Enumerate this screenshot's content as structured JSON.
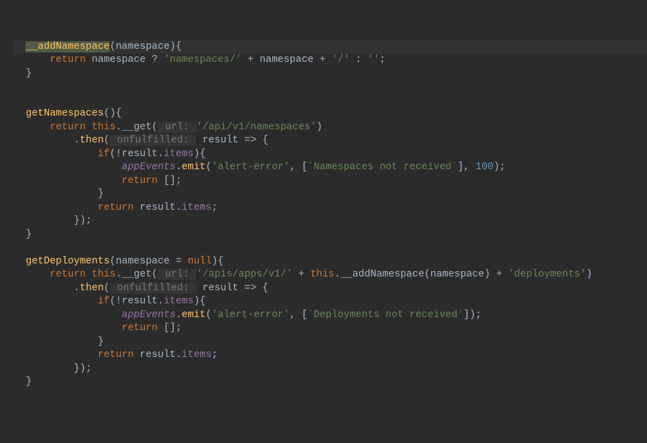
{
  "lines": {
    "l1_indent": "  ",
    "l1_method": "__addNamespace",
    "l1_rest": "(namespace){",
    "l2_indent": "      ",
    "l2_return": "return",
    "l2_ns1": " namespace ",
    "l2_q": "?",
    "l2_s1": " 'namespaces/' ",
    "l2_plus1": "+",
    "l2_ns2": " namespace ",
    "l2_plus2": "+",
    "l2_s2": " '/' ",
    "l2_colon": ":",
    "l2_s3": " ''",
    "l2_semi": ";",
    "l3": "  }",
    "l5_indent": "  ",
    "l5_method": "getNamespaces",
    "l5_rest": "(){",
    "l6_indent": "      ",
    "l6_return": "return",
    "l6_sp": " ",
    "l6_this": "this",
    "l6_dot": ".",
    "l6_get": "__get",
    "l6_paren": "(",
    "l6_hint": " url: ",
    "l6_str": "'/api/v1/namespaces'",
    "l6_end": ")",
    "l7_indent": "          .",
    "l7_then": "then",
    "l7_paren": "(",
    "l7_hint": " onfulfilled: ",
    "l7_rest": " result => {",
    "l8_indent": "              ",
    "l8_if": "if",
    "l8_rest": "(!result.",
    "l8_items": "items",
    "l8_end": "){",
    "l9_indent": "                  ",
    "l9_app": "appEvents",
    "l9_dot": ".",
    "l9_emit": "emit",
    "l9_paren": "(",
    "l9_s1": "'alert-error'",
    "l9_comma1": ", [",
    "l9_tmpl": "`Namespaces not received`",
    "l9_comma2": "], ",
    "l9_num": "100",
    "l9_end": ");",
    "l10_indent": "                  ",
    "l10_return": "return",
    "l10_rest": " [];",
    "l11": "              }",
    "l12_indent": "              ",
    "l12_return": "return",
    "l12_rest": " result.",
    "l12_items": "items",
    "l12_semi": ";",
    "l13": "          });",
    "l14": "  }",
    "l16_indent": "  ",
    "l16_method": "getDeployments",
    "l16_rest1": "(namespace = ",
    "l16_null": "null",
    "l16_rest2": "){",
    "l17_indent": "      ",
    "l17_return": "return",
    "l17_sp": " ",
    "l17_this": "this",
    "l17_dot1": ".",
    "l17_get": "__get",
    "l17_paren": "(",
    "l17_hint": " url: ",
    "l17_s1": "'/apis/apps/v1/' ",
    "l17_plus1": "+ ",
    "l17_this2": "this",
    "l17_dot2": ".",
    "l17_addns": "__addNamespace",
    "l17_rest1": "(namespace) ",
    "l17_plus2": "+ ",
    "l17_s2": "'deployments'",
    "l17_end": ")",
    "l18_indent": "          .",
    "l18_then": "then",
    "l18_paren": "(",
    "l18_hint": " onfulfilled: ",
    "l18_rest": " result => {",
    "l19_indent": "              ",
    "l19_if": "if",
    "l19_rest": "(!result.",
    "l19_items": "items",
    "l19_end": "){",
    "l20_indent": "                  ",
    "l20_app": "appEvents",
    "l20_dot": ".",
    "l20_emit": "emit",
    "l20_paren": "(",
    "l20_s1": "'alert-error'",
    "l20_comma1": ", [",
    "l20_tmpl": "`Deployments not received`",
    "l20_end": "]);",
    "l21_indent": "                  ",
    "l21_return": "return",
    "l21_rest": " [];",
    "l22": "              }",
    "l23_indent": "              ",
    "l23_return": "return",
    "l23_rest": " result.",
    "l23_items": "items",
    "l23_semi": ";",
    "l24": "          });",
    "l25": "  }"
  }
}
